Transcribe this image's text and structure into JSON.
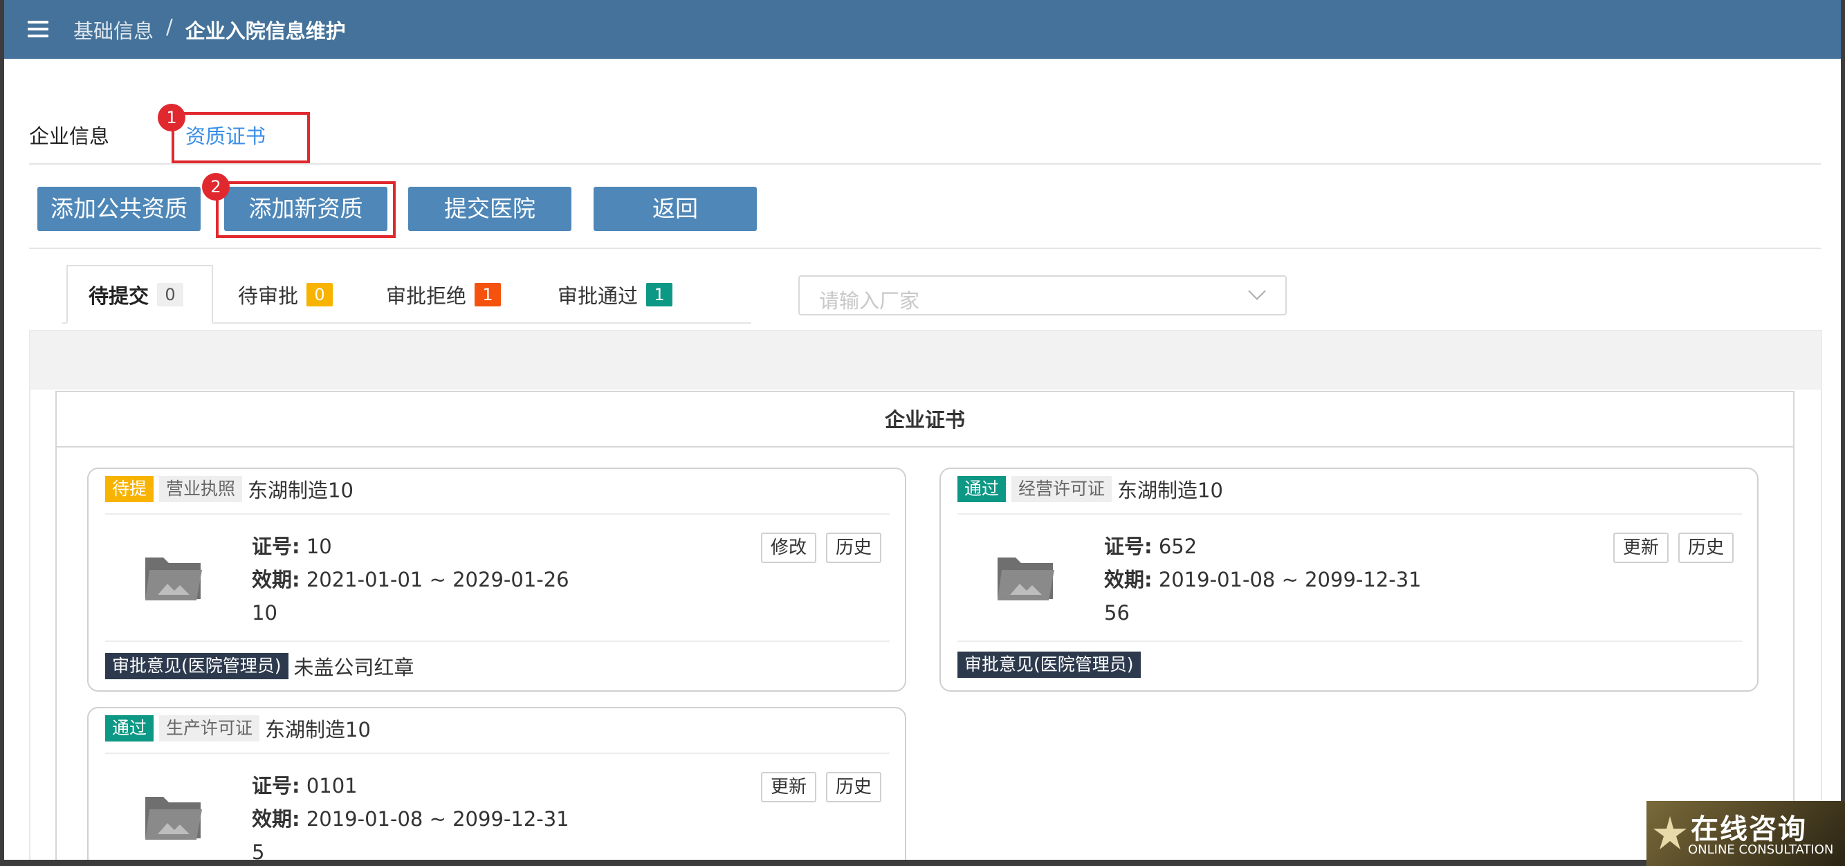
{
  "header": {
    "breadcrumb": [
      "基础信息",
      "企业入院信息维护"
    ],
    "separator": "/"
  },
  "nav_tabs": [
    {
      "label": "企业信息",
      "active": false
    },
    {
      "label": "资质证书",
      "active": true
    }
  ],
  "annotations": [
    "1",
    "2"
  ],
  "toolbar": {
    "add_public": "添加公共资质",
    "add_new": "添加新资质",
    "submit": "提交医院",
    "back": "返回"
  },
  "status_tabs": [
    {
      "label": "待提交",
      "count": "0",
      "color": "#eeeeee"
    },
    {
      "label": "待审批",
      "count": "0",
      "color": "#f8b300"
    },
    {
      "label": "审批拒绝",
      "count": "1",
      "color": "#f5520e"
    },
    {
      "label": "审批通过",
      "count": "1",
      "color": "#0d9885"
    }
  ],
  "filter": {
    "placeholder": "请输入厂家"
  },
  "panel": {
    "title": "企业证书"
  },
  "cards": [
    {
      "status": "待提",
      "type": "营业执照",
      "company": "东湖制造10",
      "number_label": "证号:",
      "number": "10",
      "validity_label": "效期:",
      "validity": "2021-01-01 ~ 2029-01-26",
      "validity_extra": "10",
      "btn1": "修改",
      "btn2": "历史",
      "opinion_label": "审批意见(医院管理员)",
      "opinion": "未盖公司红章"
    },
    {
      "status": "通过",
      "type": "经营许可证",
      "company": "东湖制造10",
      "number_label": "证号:",
      "number": "652",
      "validity_label": "效期:",
      "validity": "2019-01-08 ~ 2099-12-31",
      "validity_extra": "56",
      "btn1": "更新",
      "btn2": "历史",
      "opinion_label": "审批意见(医院管理员)",
      "opinion": ""
    },
    {
      "status": "通过",
      "type": "生产许可证",
      "company": "东湖制造10",
      "number_label": "证号:",
      "number": "0101",
      "validity_label": "效期:",
      "validity": "2019-01-08 ~ 2099-12-31",
      "validity_extra": "5",
      "btn1": "更新",
      "btn2": "历史"
    }
  ],
  "consult": {
    "cn": "在线咨询",
    "en": "ONLINE CONSULTATION"
  },
  "colors": {
    "header": "#44729a",
    "button": "#4e87b8",
    "highlight": "#e0292f",
    "link": "#3a8ee6"
  }
}
